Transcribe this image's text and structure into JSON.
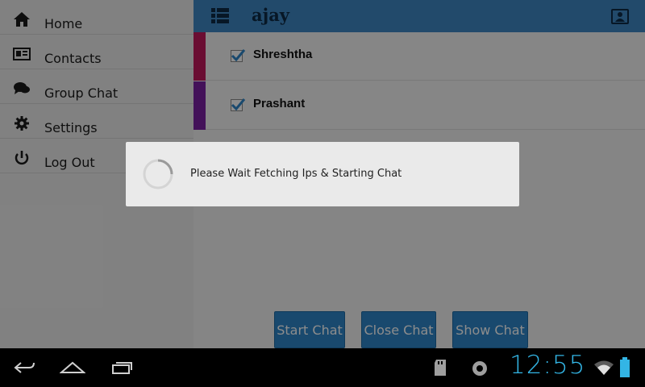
{
  "drawer": {
    "items": [
      {
        "label": "Home",
        "icon": "home-icon"
      },
      {
        "label": "Contacts",
        "icon": "contacts-card-icon"
      },
      {
        "label": "Group Chat",
        "icon": "chat-bubbles-icon"
      },
      {
        "label": "Settings",
        "icon": "gear-icon"
      },
      {
        "label": "Log Out",
        "icon": "power-icon"
      }
    ]
  },
  "topbar": {
    "title": "ajay",
    "menu_icon": "list-menu-icon",
    "profile_icon": "profile-card-icon",
    "color": "#3e88c4"
  },
  "contacts": [
    {
      "name": "Shreshtha",
      "checked": true,
      "color": "#c2185b"
    },
    {
      "name": "Prashant",
      "checked": true,
      "color": "#7b1fa2"
    }
  ],
  "actions": {
    "start_chat": "Start Chat",
    "close_chat": "Close Chat",
    "show_chat": "Show Chat"
  },
  "dialog": {
    "message": "Please Wait Fetching Ips & Starting Chat"
  },
  "system_bar": {
    "time": "12:55",
    "accent": "#33b5e5"
  }
}
